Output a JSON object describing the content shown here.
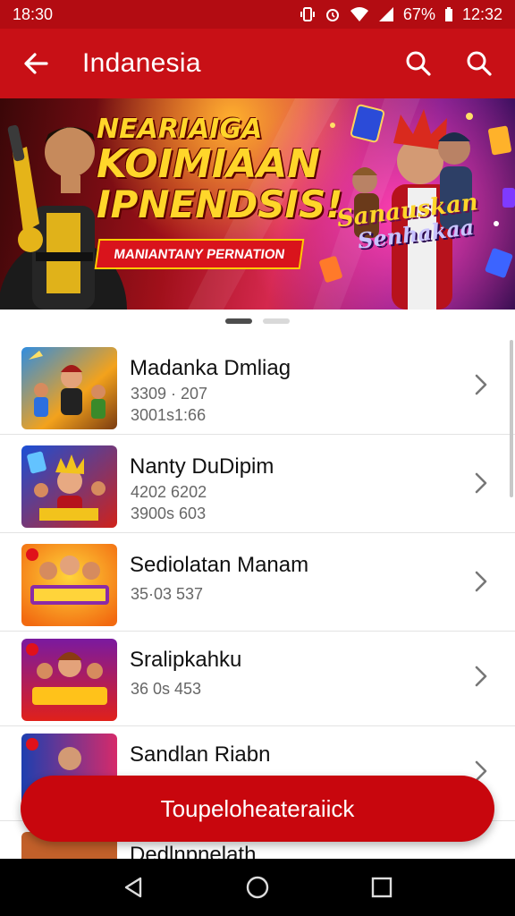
{
  "status_bar": {
    "time": "18:30",
    "battery": "67%",
    "clock_right": "12:32",
    "icons": [
      "vibrate-icon",
      "alarm-icon",
      "wifi-icon",
      "signal-icon",
      "battery-icon"
    ]
  },
  "app_bar": {
    "title": "Indanesia",
    "back_icon": "back-arrow-icon",
    "action_icons": [
      "search-icon",
      "search-icon"
    ]
  },
  "banner": {
    "headline_line1": "NEARIAIGA",
    "headline_line2": "KOIMIAAN",
    "headline_line3": "IPNENDSIS!",
    "subtitle": "MANIANTANY PERNATION",
    "logo_line1": "Sanauskan",
    "logo_line2": "Senhakaa"
  },
  "pager": {
    "count": 2,
    "active": 0
  },
  "list": {
    "items": [
      {
        "title": "Madanka Dmliag",
        "line1": "3309 · 207",
        "line2": "3001s1:66"
      },
      {
        "title": "Nanty DuDipim",
        "line1": "4202 6202",
        "line2": "3900s 603"
      },
      {
        "title": "Sediolatan Manam",
        "line1": "35·03 537",
        "line2": ""
      },
      {
        "title": "Sralipkahku",
        "line1": "36 0s 453",
        "line2": ""
      },
      {
        "title": "Sandlan Riabn",
        "line1": "",
        "line2": ""
      },
      {
        "title": "Dedlnpnelath",
        "line1": "",
        "line2": ""
      }
    ]
  },
  "cta": {
    "label": "Toupeloheateraiick"
  },
  "colors": {
    "brand_red": "#c81016",
    "status_red": "#b30c12",
    "cta_red": "#c8060d"
  }
}
